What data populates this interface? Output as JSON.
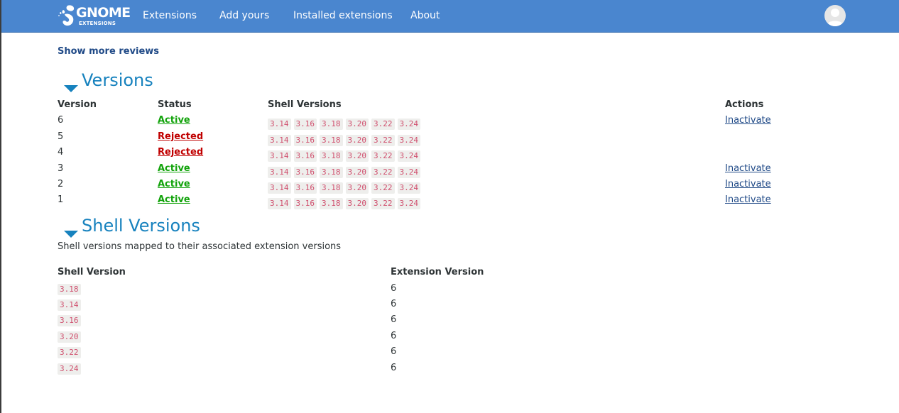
{
  "header": {
    "logo_text": "GNOME",
    "logo_sub": "EXTENSIONS",
    "nav": [
      "Extensions",
      "Add yours",
      "Installed extensions",
      "About"
    ],
    "brand_color": "#4a86cf"
  },
  "reviews": {
    "more_label": "Show more reviews"
  },
  "versions": {
    "title": "Versions",
    "columns": [
      "Version",
      "Status",
      "Shell Versions",
      "Actions"
    ],
    "rows": [
      {
        "version": "6",
        "status": "Active",
        "shells": [
          "3.14",
          "3.16",
          "3.18",
          "3.20",
          "3.22",
          "3.24"
        ],
        "action": "Inactivate"
      },
      {
        "version": "5",
        "status": "Rejected",
        "shells": [
          "3.14",
          "3.16",
          "3.18",
          "3.20",
          "3.22",
          "3.24"
        ],
        "action": ""
      },
      {
        "version": "4",
        "status": "Rejected",
        "shells": [
          "3.14",
          "3.16",
          "3.18",
          "3.20",
          "3.22",
          "3.24"
        ],
        "action": ""
      },
      {
        "version": "3",
        "status": "Active",
        "shells": [
          "3.14",
          "3.16",
          "3.18",
          "3.20",
          "3.22",
          "3.24"
        ],
        "action": "Inactivate"
      },
      {
        "version": "2",
        "status": "Active",
        "shells": [
          "3.14",
          "3.16",
          "3.18",
          "3.20",
          "3.22",
          "3.24"
        ],
        "action": "Inactivate"
      },
      {
        "version": "1",
        "status": "Active",
        "shells": [
          "3.14",
          "3.16",
          "3.18",
          "3.20",
          "3.22",
          "3.24"
        ],
        "action": "Inactivate"
      }
    ]
  },
  "shell_versions": {
    "title": "Shell Versions",
    "description": "Shell versions mapped to their associated extension versions",
    "columns": [
      "Shell Version",
      "Extension Version"
    ],
    "rows": [
      {
        "shell": "3.18",
        "ext": "6"
      },
      {
        "shell": "3.14",
        "ext": "6"
      },
      {
        "shell": "3.16",
        "ext": "6"
      },
      {
        "shell": "3.20",
        "ext": "6"
      },
      {
        "shell": "3.22",
        "ext": "6"
      },
      {
        "shell": "3.24",
        "ext": "6"
      }
    ]
  },
  "colors": {
    "active": "#12a30b",
    "rejected": "#c00000",
    "heading": "#1782be",
    "link": "#204a87"
  }
}
